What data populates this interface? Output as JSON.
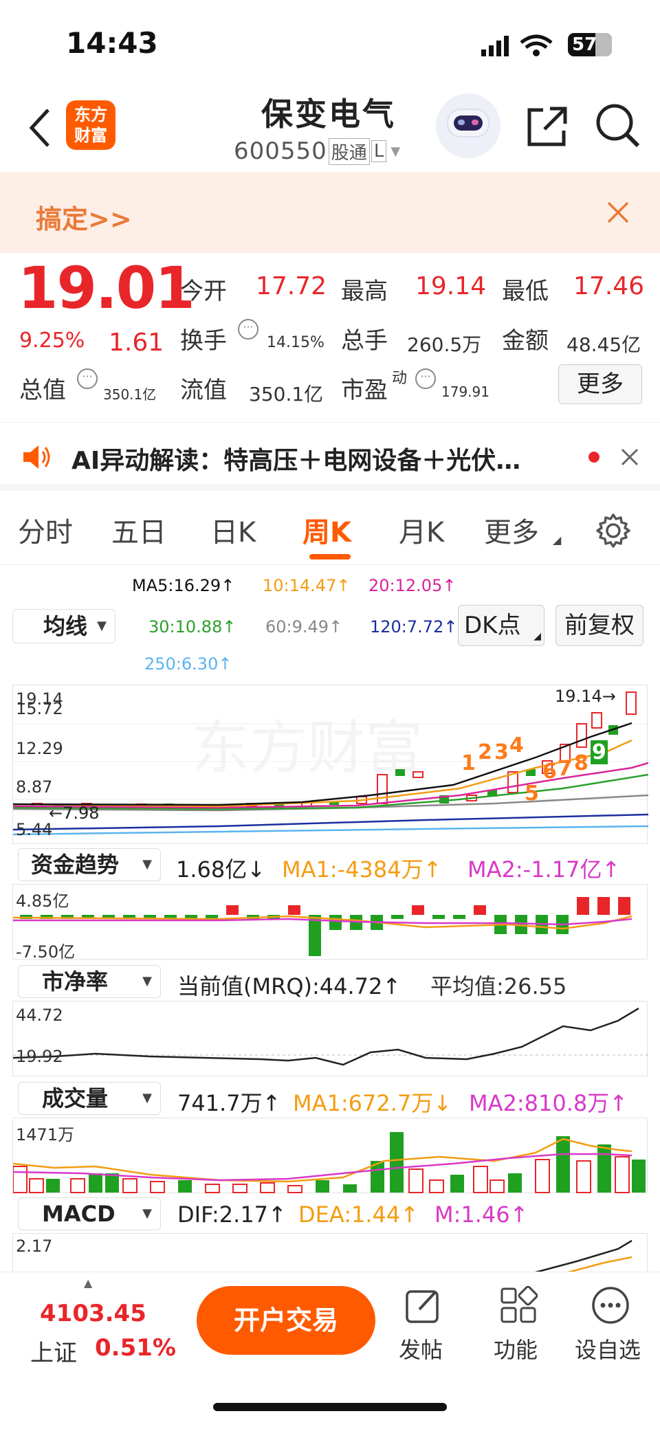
{
  "status": {
    "time": "14:43",
    "battery": "57"
  },
  "nav": {
    "title": "保变电气",
    "code": "600550",
    "tag1": "股通",
    "tag2": "L",
    "logo_line1": "东方",
    "logo_line2": "财富"
  },
  "banner": {
    "text": "搞定>>"
  },
  "quote": {
    "price": "19.01",
    "change_pct": "9.25%",
    "change": "1.61",
    "open_label": "今开",
    "open": "17.72",
    "high_label": "最高",
    "high": "19.14",
    "low_label": "最低",
    "low": "17.46",
    "turnover_label": "换手",
    "turnover": "14.15%",
    "volume_label": "总手",
    "volume": "260.5万",
    "amount_label": "金额",
    "amount": "48.45亿",
    "mktcap_label": "总值",
    "mktcap": "350.1亿",
    "float_label": "流值",
    "float": "350.1亿",
    "pe_label": "市盈",
    "pe_sup": "动",
    "pe": "179.91",
    "more_button": "更多"
  },
  "ai": {
    "text": "AI异动解读：特高压＋电网设备＋光伏…"
  },
  "tabs": {
    "items": [
      "分时",
      "五日",
      "日K",
      "周K",
      "月K",
      "更多"
    ],
    "active": 3
  },
  "ma": {
    "ma5": "MA5:16.29↑",
    "ma10": "10:14.47↑",
    "ma20": "20:12.05↑",
    "ma30": "30:10.88↑",
    "ma60": "60:9.49↑",
    "ma120": "120:7.72↑",
    "ma250": "250:6.30↑",
    "select": "均线",
    "dk_button": "DK点",
    "fq_button": "前复权"
  },
  "kline": {
    "y_labels": [
      "19.14",
      "15.72",
      "12.29",
      "8.87",
      "5.44"
    ],
    "high_marker": "19.14→",
    "low_marker": "←7.98",
    "numbers": [
      "1",
      "2",
      "3",
      "4",
      "5",
      "6",
      "7",
      "8",
      "9"
    ]
  },
  "fund": {
    "select": "资金趋势",
    "value": "1.68亿↓",
    "ma1": "MA1:-4384万↑",
    "ma2": "MA2:-1.17亿↑",
    "top": "4.85亿",
    "bottom": "-7.50亿"
  },
  "pb": {
    "select": "市净率",
    "current": "当前值(MRQ):44.72↑",
    "avg": "平均值:26.55",
    "top": "44.72",
    "bottom": "19.92"
  },
  "vol": {
    "select": "成交量",
    "value": "741.7万↑",
    "ma1": "MA1:672.7万↓",
    "ma2": "MA2:810.8万↑",
    "top": "1471万"
  },
  "macd": {
    "select": "MACD",
    "dif": "DIF:2.17↑",
    "dea": "DEA:1.44↑",
    "m": "M:1.46↑",
    "top": "2.17"
  },
  "bottom": {
    "index_value": "4103.45",
    "index_name": "上证",
    "index_pct": "0.51%",
    "trade_button": "开户交易",
    "post": "发帖",
    "func": "功能",
    "fav": "设自选"
  },
  "colors": {
    "up": "#e8262a",
    "down": "#20a020",
    "accent": "#ff5a00",
    "ma5": "#111111",
    "ma10": "#f39c12",
    "ma20": "#d8249a",
    "ma30": "#2aa02a",
    "ma60": "#888888",
    "ma120": "#1a2ea0",
    "ma250": "#5ab4ee"
  }
}
